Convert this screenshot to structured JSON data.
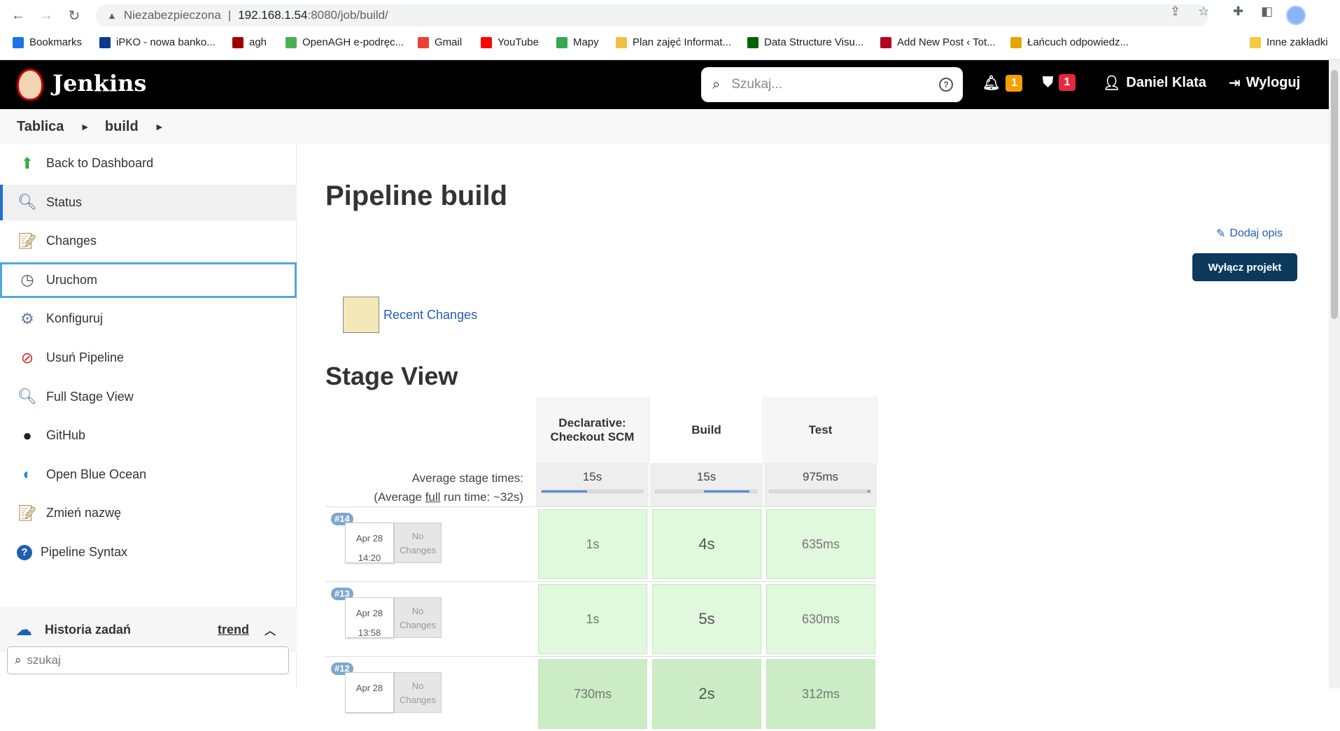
{
  "browser": {
    "security_label": "Niezabezpieczona",
    "url_host": "192.168.1.54",
    "url_path": ":8080/job/build/",
    "bookmarks": [
      {
        "label": "Bookmarks",
        "color": "#1a73e8"
      },
      {
        "label": "iPKO - nowa banko...",
        "color": "#0b3a8a"
      },
      {
        "label": "agh",
        "color": "#a00000"
      },
      {
        "label": "OpenAGH e-podręc...",
        "color": "#4caf50"
      },
      {
        "label": "Gmail",
        "color": "#ea4335"
      },
      {
        "label": "YouTube",
        "color": "#ff0000"
      },
      {
        "label": "Mapy",
        "color": "#34a853"
      },
      {
        "label": "Plan zajęć Informat...",
        "color": "#f0c040"
      },
      {
        "label": "Data Structure Visu...",
        "color": "#006400"
      },
      {
        "label": "Add New Post ‹ Tot...",
        "color": "#b00020"
      },
      {
        "label": "Łańcuch odpowiedz...",
        "color": "#e6a400"
      }
    ],
    "other_bookmarks": "Inne zakładki"
  },
  "header": {
    "app_name": "Jenkins",
    "search_placeholder": "Szukaj...",
    "notifications_count": "1",
    "security_count": "1",
    "user_name": "Daniel Klata",
    "logout_label": "Wyloguj"
  },
  "breadcrumb": [
    "Tablica",
    "build"
  ],
  "sidebar": {
    "items": [
      {
        "label": "Back to Dashboard",
        "icon": "up-arrow-icon"
      },
      {
        "label": "Status",
        "icon": "magnifier-icon"
      },
      {
        "label": "Changes",
        "icon": "notepad-icon"
      },
      {
        "label": "Uruchom",
        "icon": "clock-run-icon"
      },
      {
        "label": "Konfiguruj",
        "icon": "gear-icon"
      },
      {
        "label": "Usuń Pipeline",
        "icon": "no-entry-icon"
      },
      {
        "label": "Full Stage View",
        "icon": "magnifier-icon"
      },
      {
        "label": "GitHub",
        "icon": "github-icon"
      },
      {
        "label": "Open Blue Ocean",
        "icon": "blue-ocean-icon"
      },
      {
        "label": "Zmień nazwę",
        "icon": "notepad-icon"
      },
      {
        "label": "Pipeline Syntax",
        "icon": "help-icon"
      }
    ],
    "history_title": "Historia zadań",
    "trend_label": "trend",
    "history_search_placeholder": "szukaj"
  },
  "main": {
    "title": "Pipeline build",
    "add_description": "Dodaj opis",
    "disable_button": "Wyłącz projekt",
    "recent_changes": "Recent Changes",
    "stage_view_title": "Stage View",
    "avg_label_1": "Average stage times:",
    "avg_label_2a": "(Average ",
    "avg_label_2b": "full",
    "avg_label_2c": " run time: ~32s)",
    "stages": [
      {
        "name_line1": "Declarative:",
        "name_line2": "Checkout SCM",
        "avg": "15s",
        "avg_fill": 0.45
      },
      {
        "name_line1": "Build",
        "name_line2": "",
        "avg": "15s",
        "avg_fill": 0.45
      },
      {
        "name_line1": "Test",
        "name_line2": "",
        "avg": "975ms",
        "avg_fill": 0.02
      }
    ],
    "no_changes_line1": "No",
    "no_changes_line2": "Changes",
    "runs": [
      {
        "id": "#14",
        "date": "Apr 28",
        "time": "14:20",
        "times": [
          "1s",
          "4s",
          "635ms"
        ]
      },
      {
        "id": "#13",
        "date": "Apr 28",
        "time": "13:58",
        "times": [
          "1s",
          "5s",
          "630ms"
        ]
      },
      {
        "id": "#12",
        "date": "Apr 28",
        "time": "",
        "times": [
          "730ms",
          "2s",
          "312ms"
        ]
      }
    ]
  }
}
